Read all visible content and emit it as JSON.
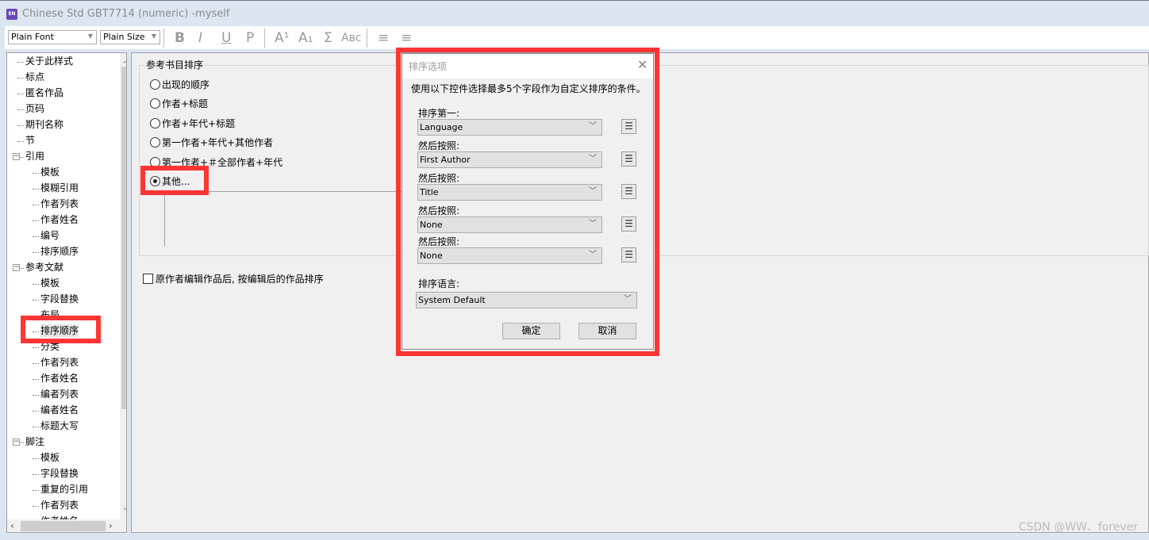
{
  "window": {
    "title": "Chinese Std GBT7714 (numeric) -myself",
    "app_icon": "EN"
  },
  "toolbar": {
    "font": "Plain Font",
    "size": "Plain Size",
    "bold": "B",
    "italic": "I",
    "underline": "U",
    "plain": "P",
    "superscript": "A¹",
    "subscript": "A₁",
    "symbol": "Σ",
    "small_caps": "Aʙᴄ",
    "align_left": "≡",
    "align_center": "≡"
  },
  "tree": {
    "items": [
      {
        "label": "关于此样式",
        "level": 0
      },
      {
        "label": "标点",
        "level": 0
      },
      {
        "label": "匿名作品",
        "level": 0
      },
      {
        "label": "页码",
        "level": 0
      },
      {
        "label": "期刊名称",
        "level": 0
      },
      {
        "label": "节",
        "level": 0
      },
      {
        "label": "引用",
        "level": 0,
        "expanded": true
      },
      {
        "label": "模板",
        "level": 1
      },
      {
        "label": "模糊引用",
        "level": 1
      },
      {
        "label": "作者列表",
        "level": 1
      },
      {
        "label": "作者姓名",
        "level": 1
      },
      {
        "label": "编号",
        "level": 1
      },
      {
        "label": "排序顺序",
        "level": 1
      },
      {
        "label": "参考文献",
        "level": 0,
        "expanded": true
      },
      {
        "label": "模板",
        "level": 1
      },
      {
        "label": "字段替换",
        "level": 1
      },
      {
        "label": "布局",
        "level": 1
      },
      {
        "label": "排序顺序",
        "level": 1,
        "selected": true
      },
      {
        "label": "分类",
        "level": 1
      },
      {
        "label": "作者列表",
        "level": 1
      },
      {
        "label": "作者姓名",
        "level": 1
      },
      {
        "label": "编者列表",
        "level": 1
      },
      {
        "label": "编者姓名",
        "level": 1
      },
      {
        "label": "标题大写",
        "level": 1
      },
      {
        "label": "脚注",
        "level": 0,
        "expanded": true
      },
      {
        "label": "模板",
        "level": 1
      },
      {
        "label": "字段替换",
        "level": 1
      },
      {
        "label": "重复的引用",
        "level": 1
      },
      {
        "label": "作者列表",
        "level": 1
      },
      {
        "label": "作者姓名",
        "level": 1
      }
    ]
  },
  "main": {
    "group_label": "参考书目排序",
    "options": [
      "出现的顺序",
      "作者+标题",
      "作者+年代+标题",
      "第一作者+年代+其他作者",
      "第一作者+＃全部作者+年代",
      "其他..."
    ],
    "selected_option": 5,
    "checkbox_label": "原作者编辑作品后, 按编辑后的作品排序",
    "checkbox_checked": false
  },
  "dialog": {
    "title": "排序选项",
    "description": "使用以下控件选择最多5个字段作为自定义排序的条件。",
    "fields": [
      {
        "label": "排序第一:",
        "value": "Language"
      },
      {
        "label": "然后按照:",
        "value": "First Author"
      },
      {
        "label": "然后按照:",
        "value": "Title"
      },
      {
        "label": "然后按照:",
        "value": "None"
      },
      {
        "label": "然后按照:",
        "value": "None"
      }
    ],
    "language_label": "排序语言:",
    "language_value": "System Default",
    "ok": "确定",
    "cancel": "取消"
  },
  "highlight_color": "#fe3535",
  "watermark": "CSDN @WW、forever"
}
